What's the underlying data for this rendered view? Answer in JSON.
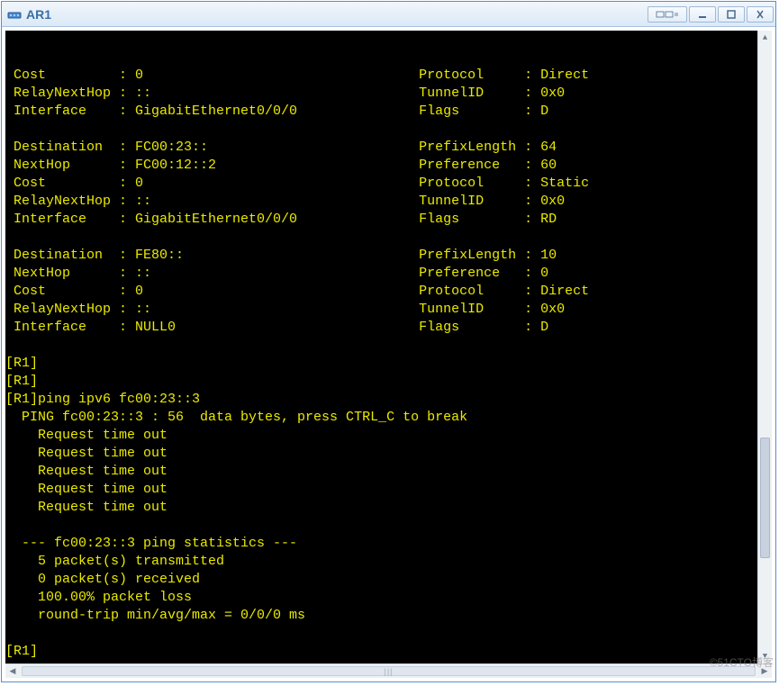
{
  "window": {
    "title": "AR1",
    "icon_name": "router-icon"
  },
  "watermark": "©51CTO博客",
  "terminal": {
    "blocks": [
      {
        "rows": [
          {
            "k": "Cost",
            "v": "0",
            "k2": "Protocol",
            "v2": "Direct"
          },
          {
            "k": "RelayNextHop",
            "v": "::",
            "k2": "TunnelID",
            "v2": "0x0"
          },
          {
            "k": "Interface",
            "v": "GigabitEthernet0/0/0",
            "k2": "Flags",
            "v2": "D"
          }
        ]
      },
      {
        "rows": [
          {
            "k": "Destination",
            "v": "FC00:23::",
            "k2": "PrefixLength",
            "v2": "64"
          },
          {
            "k": "NextHop",
            "v": "FC00:12::2",
            "k2": "Preference",
            "v2": "60"
          },
          {
            "k": "Cost",
            "v": "0",
            "k2": "Protocol",
            "v2": "Static"
          },
          {
            "k": "RelayNextHop",
            "v": "::",
            "k2": "TunnelID",
            "v2": "0x0"
          },
          {
            "k": "Interface",
            "v": "GigabitEthernet0/0/0",
            "k2": "Flags",
            "v2": "RD"
          }
        ]
      },
      {
        "rows": [
          {
            "k": "Destination",
            "v": "FE80::",
            "k2": "PrefixLength",
            "v2": "10"
          },
          {
            "k": "NextHop",
            "v": "::",
            "k2": "Preference",
            "v2": "0"
          },
          {
            "k": "Cost",
            "v": "0",
            "k2": "Protocol",
            "v2": "Direct"
          },
          {
            "k": "RelayNextHop",
            "v": "::",
            "k2": "TunnelID",
            "v2": "0x0"
          },
          {
            "k": "Interface",
            "v": "NULL0",
            "k2": "Flags",
            "v2": "D"
          }
        ]
      }
    ],
    "prompt_lines": [
      "[R1]",
      "[R1]",
      "[R1]ping ipv6 fc00:23::3"
    ],
    "ping_header": "  PING fc00:23::3 : 56  data bytes, press CTRL_C to break",
    "ping_replies": [
      "    Request time out",
      "    Request time out",
      "    Request time out",
      "    Request time out",
      "    Request time out"
    ],
    "stats_header": "  --- fc00:23::3 ping statistics ---",
    "stats_lines": [
      "    5 packet(s) transmitted",
      "    0 packet(s) received",
      "    100.00% packet loss",
      "    round-trip min/avg/max = 0/0/0 ms"
    ],
    "final_prompt": "[R1]"
  },
  "cols": {
    "k": 13,
    "v1": 35,
    "k2": 13
  }
}
